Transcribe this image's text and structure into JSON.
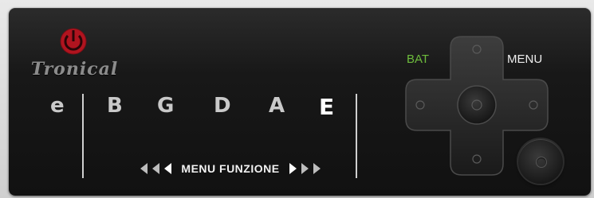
{
  "brand": {
    "name": "Tronical",
    "logo_icon": "power-icon",
    "logo_color": "#c8102e"
  },
  "strings": [
    {
      "label": "e",
      "active": false
    },
    {
      "label": "B",
      "active": false
    },
    {
      "label": "G",
      "active": false
    },
    {
      "label": "D",
      "active": false
    },
    {
      "label": "A",
      "active": false
    },
    {
      "label": "E",
      "active": true
    }
  ],
  "menu_bar": {
    "label": "MENU FUNZIONE",
    "left_icon": "triple-left-arrow-icon",
    "right_icon": "triple-right-arrow-icon"
  },
  "indicators": {
    "bat_label": "BAT",
    "bat_color": "#6dbb3c",
    "menu_label": "MENU"
  },
  "controls": {
    "dpad_icon": "dpad-icon",
    "round_button_icon": "round-button-icon"
  }
}
